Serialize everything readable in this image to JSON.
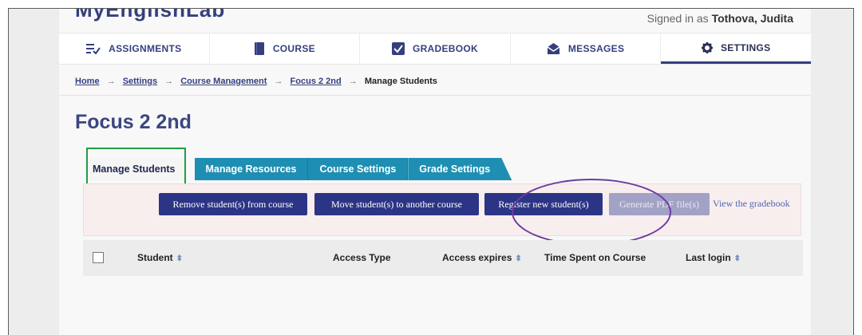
{
  "header": {
    "logo": "MyEnglishLab",
    "signed_in_prefix": "Signed in as",
    "user_name": "Tothova, Judita"
  },
  "nav": {
    "items": [
      {
        "label": "ASSIGNMENTS",
        "icon": "assignments-icon"
      },
      {
        "label": "COURSE",
        "icon": "book-icon"
      },
      {
        "label": "GRADEBOOK",
        "icon": "gradebook-icon"
      },
      {
        "label": "MESSAGES",
        "icon": "messages-icon"
      },
      {
        "label": "SETTINGS",
        "icon": "gear-icon",
        "active": true
      }
    ]
  },
  "breadcrumb": {
    "items": [
      "Home",
      "Settings",
      "Course Management",
      "Focus 2 2nd"
    ],
    "current": "Manage Students",
    "separator": "→"
  },
  "course_title": "Focus 2 2nd",
  "tabs": [
    "Manage Students",
    "Manage Resources",
    "Course Settings",
    "Grade Settings"
  ],
  "toolbar": {
    "remove": "Remove student(s) from course",
    "move": "Move student(s) to another course",
    "register": "Register new student(s)",
    "pdf": "Generate PDF file(s)",
    "view_gradebook": "View the gradebook"
  },
  "table": {
    "columns": [
      "Student",
      "Access Type",
      "Access expires",
      "Time Spent on Course",
      "Last login"
    ]
  },
  "colors": {
    "primary": "#2c3585",
    "teal_tab": "#1e8fb3",
    "highlight_green": "#1f9e45",
    "annotation_purple": "#6e3ba1"
  }
}
